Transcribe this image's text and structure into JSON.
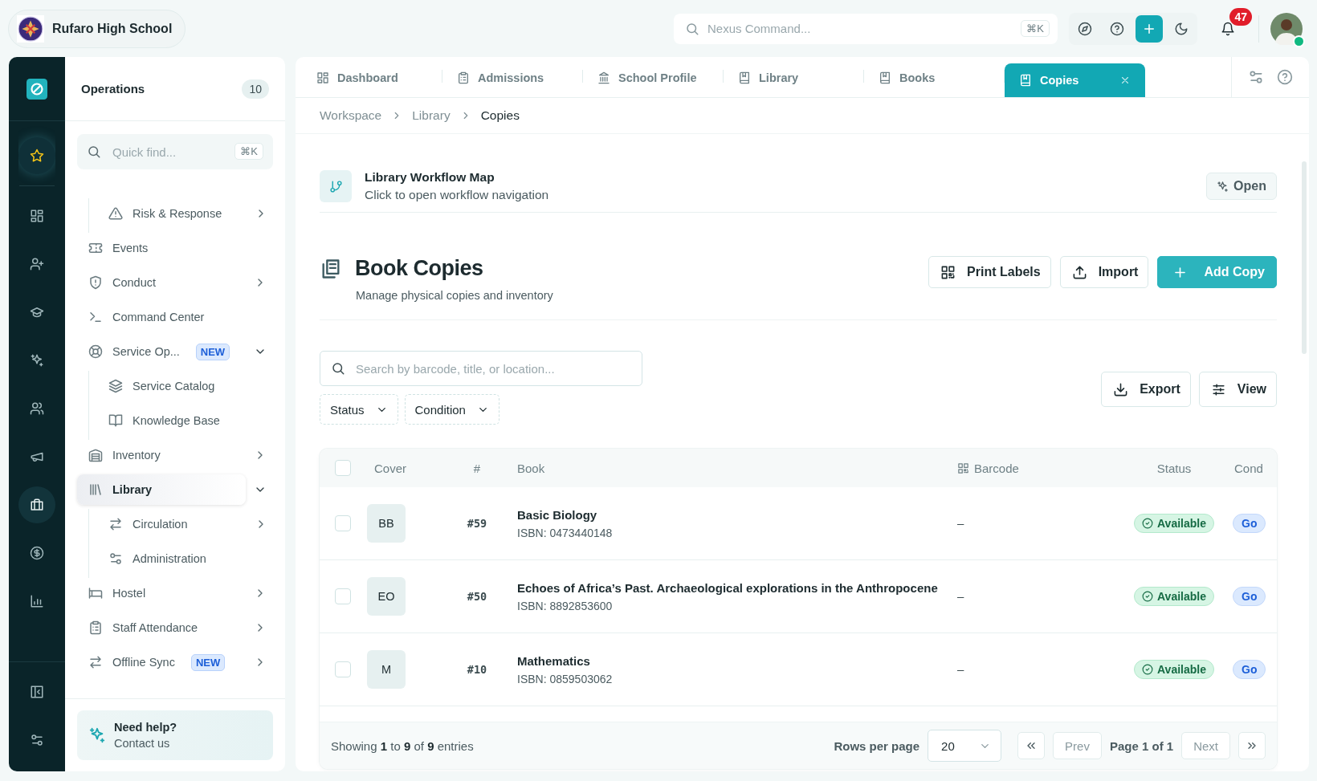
{
  "header": {
    "school_name": "Rufaro High School",
    "command_search": {
      "placeholder": "Nexus Command...",
      "shortcut": "⌘K"
    },
    "notifications_count": "47",
    "user_online": true
  },
  "rail": {
    "items": [
      {
        "selected": true,
        "active": false
      },
      {
        "selected": false,
        "active": false
      },
      {
        "selected": false,
        "active": false
      },
      {
        "selected": false,
        "active": false
      },
      {
        "selected": false,
        "active": false
      },
      {
        "selected": false,
        "active": false
      },
      {
        "selected": false,
        "active": false
      },
      {
        "selected": false,
        "active": true
      },
      {
        "selected": false,
        "active": false
      },
      {
        "selected": false,
        "active": false
      }
    ]
  },
  "sidebar": {
    "title": "Operations",
    "count": "10",
    "search": {
      "placeholder": "Quick find...",
      "shortcut": "⌘K"
    },
    "items": [
      {
        "kind": "continued",
        "children": [
          {
            "label": "Risk & Response",
            "expanded": false,
            "selected": false
          }
        ]
      },
      {
        "kind": "item",
        "label": "Events",
        "selected": false
      },
      {
        "kind": "item",
        "label": "Conduct",
        "expanded": false,
        "selected": false
      },
      {
        "kind": "item",
        "label": "Command Center",
        "selected": false
      },
      {
        "kind": "item",
        "label": "Service Op...",
        "badge": "NEW",
        "expanded": true,
        "selected": false,
        "children": [
          {
            "label": "Service Catalog",
            "selected": false
          },
          {
            "label": "Knowledge Base",
            "selected": false
          }
        ]
      },
      {
        "kind": "item",
        "label": "Inventory",
        "expanded": false,
        "selected": false
      },
      {
        "kind": "item",
        "label": "Library",
        "expanded": true,
        "selected": true,
        "children": [
          {
            "label": "Circulation",
            "expanded": false,
            "selected": false
          },
          {
            "label": "Administration",
            "selected": false
          }
        ]
      },
      {
        "kind": "item",
        "label": "Hostel",
        "expanded": false,
        "selected": false
      },
      {
        "kind": "item",
        "label": "Staff Attendance",
        "expanded": false,
        "selected": false
      },
      {
        "kind": "item",
        "label": "Offline Sync",
        "badge": "NEW",
        "expanded": false,
        "selected": false
      }
    ],
    "help": {
      "title": "Need help?",
      "subtitle": "Contact us"
    }
  },
  "tabs": [
    {
      "label": "Dashboard",
      "selected": false
    },
    {
      "label": "Admissions",
      "selected": false
    },
    {
      "label": "School Profile",
      "selected": false
    },
    {
      "label": "Library",
      "selected": false
    },
    {
      "label": "Books",
      "selected": false
    },
    {
      "label": "Copies",
      "selected": true
    }
  ],
  "breadcrumb": [
    {
      "label": "Workspace",
      "current": false
    },
    {
      "label": "Library",
      "current": false
    },
    {
      "label": "Copies",
      "current": true
    }
  ],
  "workflow_card": {
    "title": "Library Workflow Map",
    "subtitle": "Click to open workflow navigation",
    "button": "Open"
  },
  "page_header": {
    "title": "Book Copies",
    "subtitle": "Manage physical copies and inventory",
    "buttons": [
      {
        "label": "Print Labels",
        "kind": "print"
      },
      {
        "label": "Import",
        "kind": "import"
      },
      {
        "label": "Add Copy",
        "kind": "add"
      }
    ]
  },
  "search": {
    "placeholder": "Search by barcode, title, or location..."
  },
  "filters": [
    "Status",
    "Condition"
  ],
  "toolbar_buttons": [
    {
      "label": "Export",
      "kind": "export"
    },
    {
      "label": "View",
      "kind": "view"
    }
  ],
  "table": {
    "all_selected": false,
    "columns": [
      "Cover",
      "#",
      "Book",
      "Barcode",
      "Status",
      "Cond"
    ],
    "rows": [
      {
        "checked": false,
        "cover": "BB",
        "number": "#59",
        "title": "Basic Biology",
        "isbn": "ISBN: 0473440148",
        "barcode": "–",
        "status": "Available",
        "condition": "Go"
      },
      {
        "checked": false,
        "cover": "EO",
        "number": "#50",
        "title": "Echoes of Africa’s Past. Archaeological explorations in the Anthropocene",
        "isbn": "ISBN: 8892853600",
        "barcode": "–",
        "status": "Available",
        "condition": "Go"
      },
      {
        "checked": false,
        "cover": "M",
        "number": "#10",
        "title": "Mathematics",
        "isbn": "ISBN: 0859503062",
        "barcode": "–",
        "status": "Available",
        "condition": "Go"
      }
    ]
  },
  "footer": {
    "showing": "Showing **1** to **9** of **9** entries",
    "rows_per_page_label": "Rows per page",
    "rows_per_page": "20",
    "prev": "Prev",
    "page": "Page 1 of 1",
    "next": "Next"
  }
}
